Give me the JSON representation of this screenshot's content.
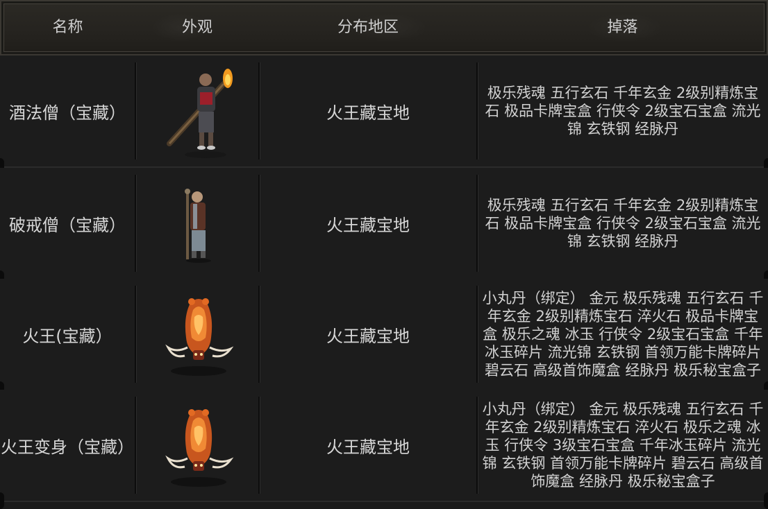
{
  "header": {
    "col_name": "名称",
    "col_look": "外观",
    "col_region": "分布地区",
    "col_drops": "掉落"
  },
  "rows": [
    {
      "name": "酒法僧（宝藏）",
      "appearance_icon": "monk-with-torch-staff",
      "region": "火王藏宝地",
      "drops": "极乐残魂 五行玄石 千年玄金 2级别精炼宝石 极品卡牌宝盒 行侠令 2级宝石宝盒 流光锦 玄铁钢 经脉丹"
    },
    {
      "name": "破戒僧（宝藏）",
      "appearance_icon": "bald-monk-with-staff",
      "region": "火王藏宝地",
      "drops": "极乐残魂 五行玄石 千年玄金 2级别精炼宝石 极品卡牌宝盒 行侠令 2级宝石宝盒 流光锦 玄铁钢 经脉丹"
    },
    {
      "name": "火王(宝藏）",
      "appearance_icon": "fire-beast",
      "region": "火王藏宝地",
      "drops": "小丸丹（绑定） 金元 极乐残魂 五行玄石 千年玄金 2级别精炼宝石 淬火石 极品卡牌宝盒 极乐之魂 冰玉 行侠令 2级宝石宝盒 千年冰玉碎片 流光锦 玄铁钢 首领万能卡牌碎片 碧云石 高级首饰魔盒 经脉丹 极乐秘宝盒子"
    },
    {
      "name": "火王变身（宝藏）",
      "appearance_icon": "fire-beast-transformed",
      "region": "火王藏宝地",
      "drops": "小丸丹（绑定） 金元 极乐残魂 五行玄石 千年玄金 2级别精炼宝石 淬火石 极乐之魂 冰玉 行侠令 3级宝石宝盒 千年冰玉碎片 流光锦 玄铁钢 首领万能卡牌碎片 碧云石 高级首饰魔盒 经脉丹 极乐秘宝盒子"
    }
  ],
  "colors": {
    "background": "#1b1b1b",
    "text": "#d2d2d2",
    "fire": "#e8772a"
  }
}
